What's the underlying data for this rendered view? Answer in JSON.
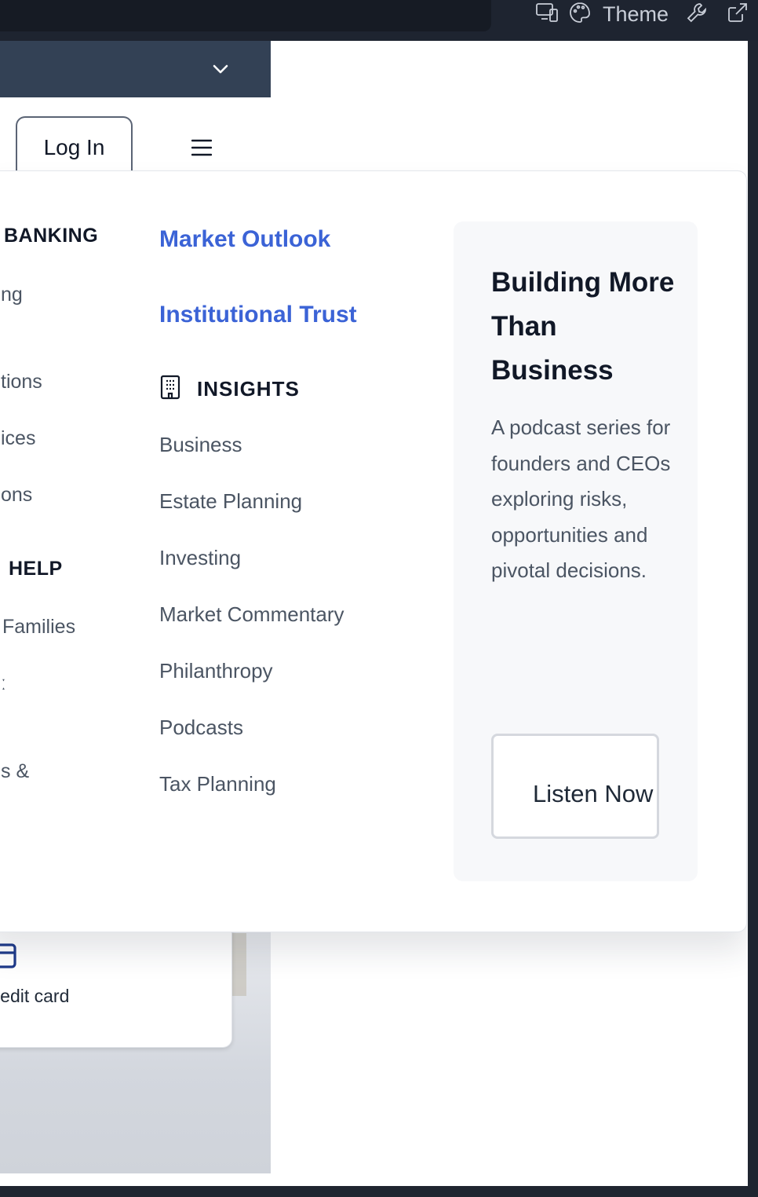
{
  "toolbar": {
    "theme_label": "Theme",
    "icons": [
      "devices-icon",
      "palette-icon",
      "wrench-icon",
      "external-link-icon"
    ]
  },
  "header": {
    "login_label": "Log In",
    "icons": [
      "chevron-down-icon",
      "hamburger-menu-icon"
    ]
  },
  "menu": {
    "col1": {
      "heading_banking": "BANKING",
      "items_top": [
        "ng",
        "tions",
        "ices",
        "ons"
      ],
      "heading_help": "HELP",
      "items_bottom": [
        "Families",
        "ː",
        "s &"
      ]
    },
    "col2": {
      "featured": [
        "Market Outlook",
        "Institutional Trust"
      ],
      "insights_heading": "INSIGHTS",
      "insights_icon": "building-icon",
      "links": [
        "Business",
        "Estate Planning",
        "Investing",
        "Market Commentary",
        "Philanthropy",
        "Podcasts",
        "Tax Planning"
      ]
    },
    "promo": {
      "title": "Building More Than Business",
      "description": "A podcast series for founders and CEOs exploring risks, opportunities and pivotal decisions.",
      "button_label": "Listen Now"
    }
  },
  "behind": {
    "card_text": "credit card",
    "card_icon": "credit-card-icon"
  },
  "colors": {
    "accent_link": "#3b63d6",
    "navbar": "#334155",
    "toolbar": "#1e2430"
  }
}
